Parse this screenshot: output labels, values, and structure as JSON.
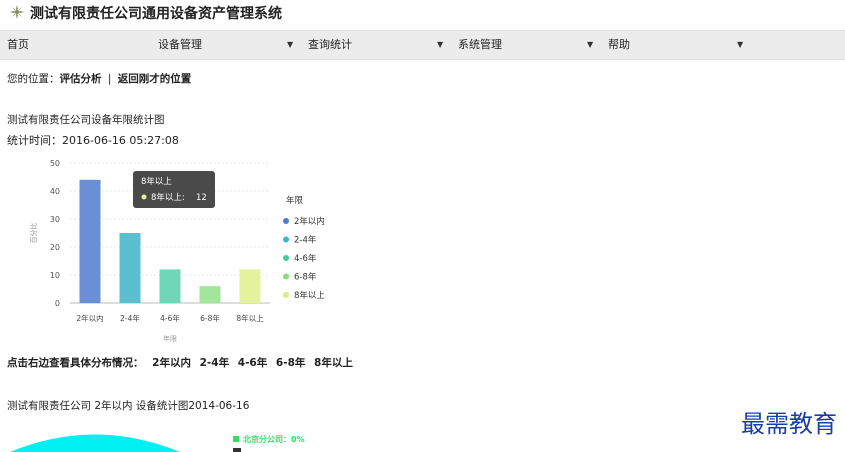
{
  "app": {
    "title": "测试有限责任公司通用设备资产管理系统"
  },
  "nav": {
    "items": [
      {
        "label": "首页",
        "has_caret": false
      },
      {
        "label": "设备管理",
        "has_caret": true
      },
      {
        "label": "查询统计",
        "has_caret": true
      },
      {
        "label": "系统管理",
        "has_caret": true
      },
      {
        "label": "帮助",
        "has_caret": true
      }
    ],
    "caret": "▼"
  },
  "breadcrumb": {
    "prefix": "您的位置：",
    "current": "评估分析",
    "separator": "|",
    "back": "返回刚才的位置"
  },
  "chart_title": "测试有限责任公司设备年限统计图",
  "stat_time": "统计时间：2016-06-16 05:27:08",
  "chart_data": {
    "type": "bar",
    "categories": [
      "2年以内",
      "2-4年",
      "4-6年",
      "6-8年",
      "8年以上"
    ],
    "values": [
      44,
      25,
      12,
      6,
      12
    ],
    "colors": [
      "#6a8fd6",
      "#5bbfcf",
      "#6fd6b8",
      "#a2e59b",
      "#e4f29d"
    ],
    "ylim": [
      0,
      50
    ],
    "yticks": [
      0,
      10,
      20,
      30,
      40,
      50
    ],
    "ylabel": "百分比",
    "xlabel": "年限",
    "legend": {
      "title": "年限",
      "position": "right",
      "items": [
        "2年以内",
        "2-4年",
        "4-6年",
        "6-8年",
        "8年以上"
      ],
      "colors": [
        "#4e7ad2",
        "#3cb7c9",
        "#46c9a2",
        "#88dc7c",
        "#d9ee80"
      ]
    },
    "tooltip": {
      "title": "8年以上",
      "label": "8年以上:",
      "value": 12
    }
  },
  "distribution": {
    "prompt": "点击右边查看具体分布情况：",
    "links": [
      "2年以内",
      "2-4年",
      "4-6年",
      "6-8年",
      "8年以上"
    ]
  },
  "sub_chart": {
    "title": "测试有限责任公司 2年以内 设备统计图2014-06-16",
    "legend": [
      {
        "label": "北京分公司：0%",
        "color": "#33dd66"
      }
    ],
    "color": "#00f0f4"
  },
  "watermark": "最需教育"
}
